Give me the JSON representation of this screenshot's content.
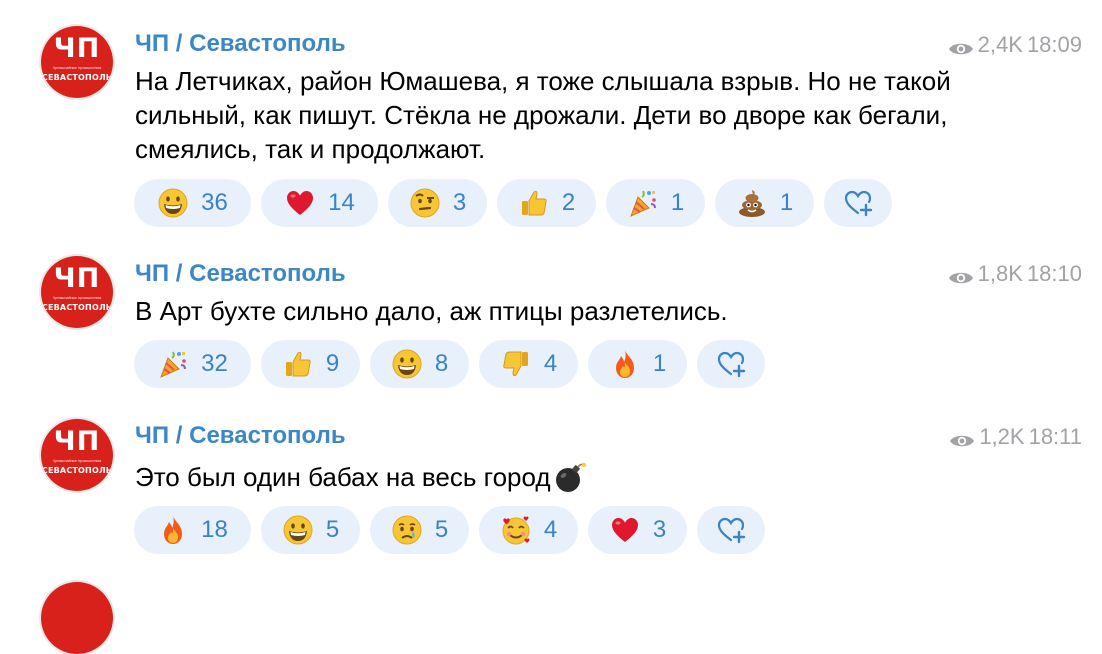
{
  "messages": [
    {
      "author": "ЧП / Севастополь",
      "avatar": {
        "main": "ЧП",
        "tiny": "Чрезвычайные происшествия",
        "sub": "СЕВАСТОПОЛЬ"
      },
      "views": "2,4K",
      "time": "18:09",
      "text": "На Летчиках, район Юмашева, я тоже слышала взрыв. Но не такой сильный, как пишут. Стёкла не дрожали. Дети во дворе как бегали, смеялись, так и продолжают.",
      "reactions": [
        {
          "emoji": "grinning-face",
          "count": "36"
        },
        {
          "emoji": "red-heart",
          "count": "14"
        },
        {
          "emoji": "face-with-raised-eyebrow",
          "count": "3"
        },
        {
          "emoji": "thumbs-up",
          "count": "2"
        },
        {
          "emoji": "party-popper",
          "count": "1"
        },
        {
          "emoji": "pile-of-poo",
          "count": "1"
        }
      ]
    },
    {
      "author": "ЧП / Севастополь",
      "avatar": {
        "main": "ЧП",
        "tiny": "Чрезвычайные происшествия",
        "sub": "СЕВАСТОПОЛЬ"
      },
      "views": "1,8K",
      "time": "18:10",
      "text": "В Арт бухте сильно дало, аж птицы разлетелись.",
      "reactions": [
        {
          "emoji": "party-popper",
          "count": "32"
        },
        {
          "emoji": "thumbs-up",
          "count": "9"
        },
        {
          "emoji": "grinning-face",
          "count": "8"
        },
        {
          "emoji": "thumbs-down",
          "count": "4"
        },
        {
          "emoji": "fire",
          "count": "1"
        }
      ]
    },
    {
      "author": "ЧП / Севастополь",
      "avatar": {
        "main": "ЧП",
        "tiny": "Чрезвычайные происшествия",
        "sub": "СЕВАСТОПОЛЬ"
      },
      "views": "1,2K",
      "time": "18:11",
      "text": "Это был один бабах на весь город",
      "text_emoji": "bomb",
      "reactions": [
        {
          "emoji": "fire",
          "count": "18"
        },
        {
          "emoji": "grinning-face",
          "count": "5"
        },
        {
          "emoji": "crying-face",
          "count": "5"
        },
        {
          "emoji": "smiling-face-with-hearts",
          "count": "4"
        },
        {
          "emoji": "red-heart",
          "count": "3"
        }
      ]
    }
  ],
  "add_reaction_icon": "heart-plus-icon",
  "colors": {
    "accent": "#3d87c4",
    "pill_bg": "#e8f1fb",
    "avatar_red": "#d9211b",
    "meta_gray": "#a2a2a7"
  }
}
